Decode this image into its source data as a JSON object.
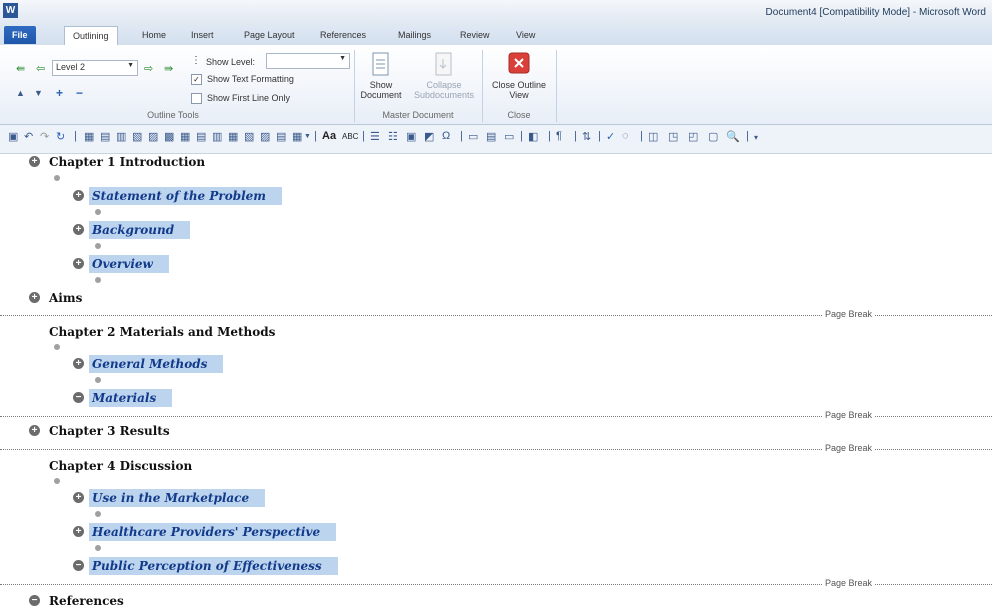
{
  "window": {
    "title": "Document4 [Compatibility Mode]  -  Microsoft Word",
    "app_icon": "W"
  },
  "tabs": [
    "File",
    "Outlining",
    "Home",
    "Insert",
    "Page Layout",
    "References",
    "Mailings",
    "Review",
    "View"
  ],
  "active_tab": "Outlining",
  "ribbon": {
    "level_value": "Level 2",
    "show_level_label": "Show Level:",
    "show_level_value": "",
    "show_text_formatting_label": "Show Text Formatting",
    "show_text_formatting_checked": true,
    "show_first_line_label": "Show First Line Only",
    "show_first_line_checked": false,
    "outline_tools_label": "Outline Tools",
    "show_document_label": "Show Document",
    "collapse_subdocs_label": "Collapse Subdocuments",
    "master_document_label": "Master Document",
    "close_outline_label": "Close Outline View",
    "close_group_label": "Close"
  },
  "outline": [
    {
      "text": "Chapter 1 Introduction",
      "level": 1,
      "symbol": "plus"
    },
    {
      "text": "Statement of the Problem",
      "level": 2,
      "symbol": "plus"
    },
    {
      "text": "Background",
      "level": 2,
      "symbol": "plus"
    },
    {
      "text": "Overview",
      "level": 2,
      "symbol": "plus"
    },
    {
      "text": "Aims",
      "level": 1,
      "symbol": "plus"
    },
    {
      "text": "Chapter 2 Materials and Methods",
      "level": 1,
      "symbol": "none"
    },
    {
      "text": "General Methods",
      "level": 2,
      "symbol": "plus"
    },
    {
      "text": "Materials",
      "level": 2,
      "symbol": "minus"
    },
    {
      "text": "Chapter 3 Results",
      "level": 1,
      "symbol": "plus"
    },
    {
      "text": "Chapter 4 Discussion",
      "level": 1,
      "symbol": "none"
    },
    {
      "text": "Use in the Marketplace",
      "level": 2,
      "symbol": "plus"
    },
    {
      "text": "Healthcare Providers' Perspective",
      "level": 2,
      "symbol": "plus"
    },
    {
      "text": "Public Perception of Effectiveness",
      "level": 2,
      "symbol": "minus"
    },
    {
      "text": "References",
      "level": 1,
      "symbol": "minus"
    }
  ],
  "page_break_label": "Page Break",
  "colors": {
    "highlight": "#bcd4ee",
    "heading2": "#123a8a",
    "file_tab": "#2f6bc2",
    "close_button": "#d9403a"
  }
}
